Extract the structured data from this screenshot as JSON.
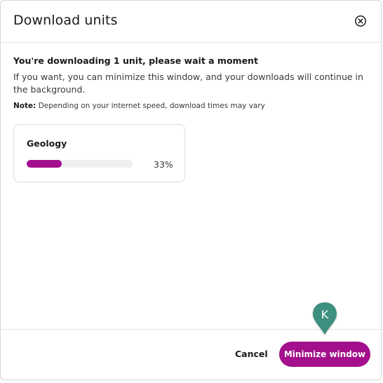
{
  "dialog": {
    "title": "Download units",
    "close_icon": "close-circle-icon"
  },
  "body": {
    "heading": "You're downloading 1 unit, please wait a moment",
    "description": "If you want, you can minimize this window, and your downloads will continue in the background.",
    "note_label": "Note:",
    "note_text": "Depending on your internet speed, download times may vary"
  },
  "downloads": [
    {
      "name": "Geology",
      "progress_percent": 33,
      "progress_label": "33%"
    }
  ],
  "footer": {
    "cancel_label": "Cancel",
    "minimize_label": "Minimize window"
  },
  "marker": {
    "label": "K",
    "color": "#3d8f7f"
  },
  "colors": {
    "accent": "#a30f8c",
    "progress_track": "#efefef"
  }
}
